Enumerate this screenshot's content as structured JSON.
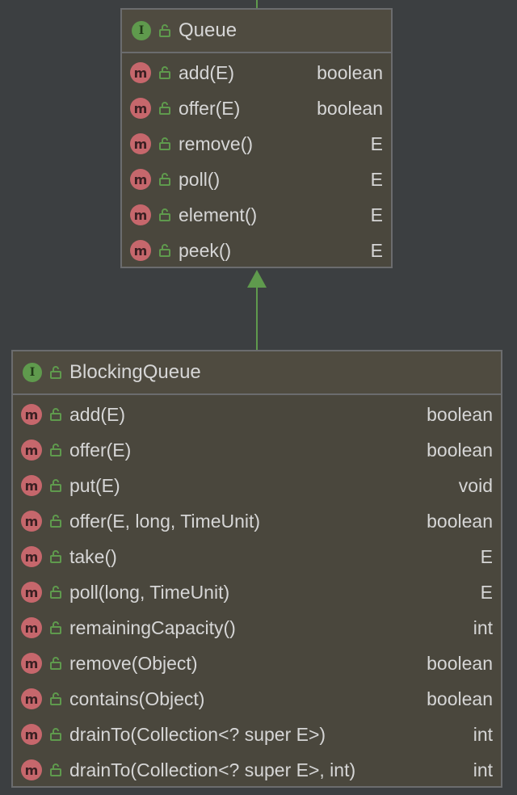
{
  "colors": {
    "background": "#3c3f41",
    "box_fill": "#4a473d",
    "box_border": "#6b6c6e",
    "text": "#d6d6d6",
    "interface_icon": "#5f9a4d",
    "method_icon": "#c6676c",
    "arrow": "#5f9a4d"
  },
  "queue": {
    "icon": "interface-icon",
    "title": "Queue",
    "methods": [
      {
        "name": "add(E)",
        "type": "boolean"
      },
      {
        "name": "offer(E)",
        "type": "boolean"
      },
      {
        "name": "remove()",
        "type": "E"
      },
      {
        "name": "poll()",
        "type": "E"
      },
      {
        "name": "element()",
        "type": "E"
      },
      {
        "name": "peek()",
        "type": "E"
      }
    ]
  },
  "blocking_queue": {
    "icon": "interface-icon",
    "title": "BlockingQueue",
    "methods": [
      {
        "name": "add(E)",
        "type": "boolean"
      },
      {
        "name": "offer(E)",
        "type": "boolean"
      },
      {
        "name": "put(E)",
        "type": "void"
      },
      {
        "name": "offer(E, long, TimeUnit)",
        "type": "boolean"
      },
      {
        "name": "take()",
        "type": "E"
      },
      {
        "name": "poll(long, TimeUnit)",
        "type": "E"
      },
      {
        "name": "remainingCapacity()",
        "type": "int"
      },
      {
        "name": "remove(Object)",
        "type": "boolean"
      },
      {
        "name": "contains(Object)",
        "type": "boolean"
      },
      {
        "name": "drainTo(Collection<? super E>)",
        "type": "int"
      },
      {
        "name": "drainTo(Collection<? super E>, int)",
        "type": "int"
      }
    ]
  },
  "icons": {
    "interface_letter": "I",
    "method_letter": "m"
  },
  "edges": [
    {
      "from": "blocking_queue",
      "to": "queue",
      "kind": "extends"
    }
  ]
}
